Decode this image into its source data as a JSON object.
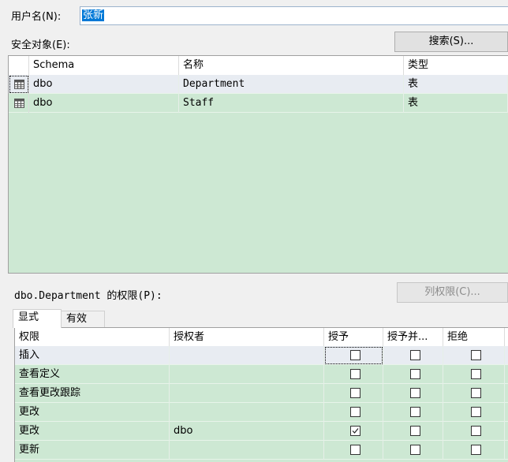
{
  "user": {
    "label": "用户名(N):",
    "value": "张新"
  },
  "securables": {
    "label": "安全对象(E):",
    "search_button": "搜索(S)...",
    "columns": [
      "Schema",
      "名称",
      "类型"
    ],
    "rows": [
      {
        "icon": "table-icon",
        "schema": "dbo",
        "name": "Department",
        "type": "表"
      },
      {
        "icon": "table-icon",
        "schema": "dbo",
        "name": "Staff",
        "type": "表"
      }
    ]
  },
  "permissions": {
    "label": "dbo.Department 的权限(P):",
    "column_perm_button": "列权限(C)...",
    "tabs": [
      "显式",
      "有效"
    ],
    "active_tab": "显式",
    "columns": [
      "权限",
      "授权者",
      "授予",
      "授予并...",
      "拒绝"
    ],
    "rows": [
      {
        "permission": "插入",
        "grantor": "",
        "grant": false,
        "with_grant": false,
        "deny": false
      },
      {
        "permission": "查看定义",
        "grantor": "",
        "grant": false,
        "with_grant": false,
        "deny": false
      },
      {
        "permission": "查看更改跟踪",
        "grantor": "",
        "grant": false,
        "with_grant": false,
        "deny": false
      },
      {
        "permission": "更改",
        "grantor": "",
        "grant": false,
        "with_grant": false,
        "deny": false
      },
      {
        "permission": "更改",
        "grantor": "dbo",
        "grant": true,
        "with_grant": false,
        "deny": false
      },
      {
        "permission": "更新",
        "grantor": "",
        "grant": false,
        "with_grant": false,
        "deny": false
      }
    ]
  },
  "colors": {
    "grid_bg": "#cde8d3",
    "selection": "#0078d7",
    "selected_row": "#e8ecf2"
  }
}
